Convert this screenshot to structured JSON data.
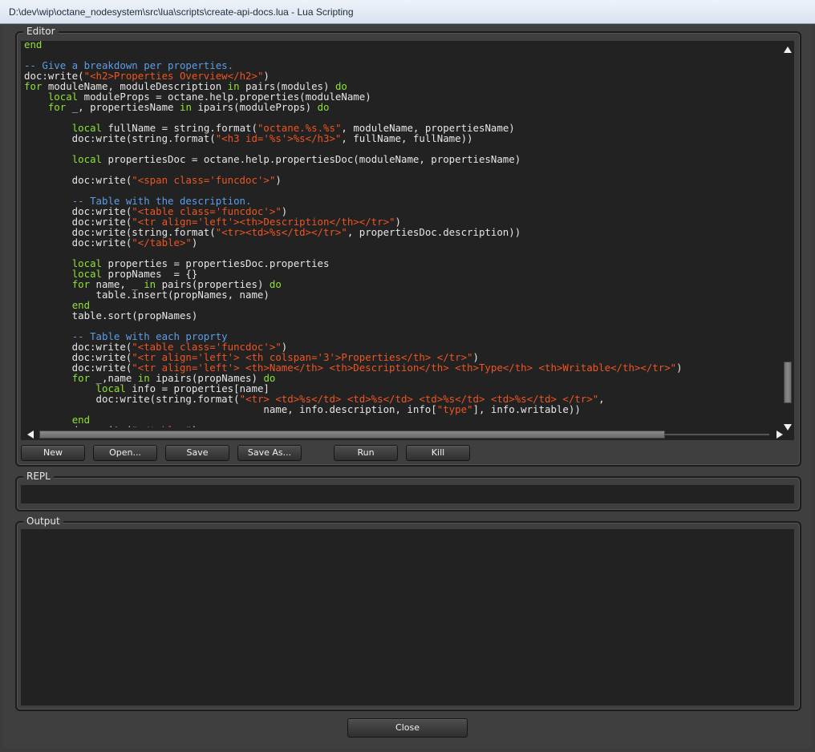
{
  "window": {
    "title": "D:\\dev\\wip\\octane_nodesystem\\src\\lua\\scripts\\create-api-docs.lua - Lua Scripting"
  },
  "editor": {
    "label": "Editor",
    "buttons": {
      "new": "New",
      "open": "Open...",
      "save": "Save",
      "save_as": "Save As...",
      "run": "Run",
      "kill": "Kill"
    }
  },
  "repl": {
    "label": "REPL",
    "value": ""
  },
  "output": {
    "label": "Output",
    "value": ""
  },
  "footer": {
    "close": "Close"
  },
  "code_lines": [
    [
      [
        "kw",
        "end"
      ]
    ],
    [],
    [
      [
        "cmt",
        "-- Give a breakdown per properties."
      ]
    ],
    [
      [
        "t",
        "doc:write("
      ],
      [
        "str",
        "\"<h2>Properties Overview</h2>\""
      ],
      [
        "t",
        ")"
      ]
    ],
    [
      [
        "kw",
        "for"
      ],
      [
        "t",
        " moduleName, moduleDescription "
      ],
      [
        "kw",
        "in"
      ],
      [
        "t",
        " pairs(modules) "
      ],
      [
        "kw",
        "do"
      ]
    ],
    [
      [
        "t",
        "    "
      ],
      [
        "kw",
        "local"
      ],
      [
        "t",
        " moduleProps = octane.help.properties(moduleName)"
      ]
    ],
    [
      [
        "t",
        "    "
      ],
      [
        "kw",
        "for"
      ],
      [
        "t",
        " _, propertiesName "
      ],
      [
        "kw",
        "in"
      ],
      [
        "t",
        " ipairs(moduleProps) "
      ],
      [
        "kw",
        "do"
      ]
    ],
    [],
    [
      [
        "t",
        "        "
      ],
      [
        "kw",
        "local"
      ],
      [
        "t",
        " fullName = string.format("
      ],
      [
        "str",
        "\"octane.%s.%s\""
      ],
      [
        "t",
        ", moduleName, propertiesName)"
      ]
    ],
    [
      [
        "t",
        "        doc:write(string.format("
      ],
      [
        "str",
        "\"<h3 id='%s'>%s</h3>\""
      ],
      [
        "t",
        ", fullName, fullName))"
      ]
    ],
    [],
    [
      [
        "t",
        "        "
      ],
      [
        "kw",
        "local"
      ],
      [
        "t",
        " propertiesDoc = octane.help.propertiesDoc(moduleName, propertiesName)"
      ]
    ],
    [],
    [
      [
        "t",
        "        doc:write("
      ],
      [
        "str",
        "\"<span class='funcdoc'>\""
      ],
      [
        "t",
        ")"
      ]
    ],
    [],
    [
      [
        "t",
        "        "
      ],
      [
        "cmt",
        "-- Table with the description."
      ]
    ],
    [
      [
        "t",
        "        doc:write("
      ],
      [
        "str",
        "\"<table class='funcdoc'>\""
      ],
      [
        "t",
        ")"
      ]
    ],
    [
      [
        "t",
        "        doc:write("
      ],
      [
        "str",
        "\"<tr align='left'><th>Description</th></tr>\""
      ],
      [
        "t",
        ")"
      ]
    ],
    [
      [
        "t",
        "        doc:write(string.format("
      ],
      [
        "str",
        "\"<tr><td>%s</td></tr>\""
      ],
      [
        "t",
        ", propertiesDoc.description))"
      ]
    ],
    [
      [
        "t",
        "        doc:write("
      ],
      [
        "str",
        "\"</table>\""
      ],
      [
        "t",
        ")"
      ]
    ],
    [],
    [
      [
        "t",
        "        "
      ],
      [
        "kw",
        "local"
      ],
      [
        "t",
        " properties = propertiesDoc.properties"
      ]
    ],
    [
      [
        "t",
        "        "
      ],
      [
        "kw",
        "local"
      ],
      [
        "t",
        " propNames  = {}"
      ]
    ],
    [
      [
        "t",
        "        "
      ],
      [
        "kw",
        "for"
      ],
      [
        "t",
        " name, _ "
      ],
      [
        "kw",
        "in"
      ],
      [
        "t",
        " pairs(properties) "
      ],
      [
        "kw",
        "do"
      ]
    ],
    [
      [
        "t",
        "            table.insert(propNames, name)"
      ]
    ],
    [
      [
        "t",
        "        "
      ],
      [
        "kw",
        "end"
      ]
    ],
    [
      [
        "t",
        "        table.sort(propNames)"
      ]
    ],
    [],
    [
      [
        "t",
        "        "
      ],
      [
        "cmt",
        "-- Table with each proprty"
      ]
    ],
    [
      [
        "t",
        "        doc:write("
      ],
      [
        "str",
        "\"<table class='funcdoc'>\""
      ],
      [
        "t",
        ")"
      ]
    ],
    [
      [
        "t",
        "        doc:write("
      ],
      [
        "str",
        "\"<tr align='left'> <th colspan='3'>Properties</th> </tr>\""
      ],
      [
        "t",
        ")"
      ]
    ],
    [
      [
        "t",
        "        doc:write("
      ],
      [
        "str",
        "\"<tr align='left'> <th>Name</th> <th>Description</th> <th>Type</th> <th>Writable</th></tr>\""
      ],
      [
        "t",
        ")"
      ]
    ],
    [
      [
        "t",
        "        "
      ],
      [
        "kw",
        "for"
      ],
      [
        "t",
        " _,name "
      ],
      [
        "kw",
        "in"
      ],
      [
        "t",
        " ipairs(propNames) "
      ],
      [
        "kw",
        "do"
      ]
    ],
    [
      [
        "t",
        "            "
      ],
      [
        "kw",
        "local"
      ],
      [
        "t",
        " info = properties[name]"
      ]
    ],
    [
      [
        "t",
        "            doc:write(string.format("
      ],
      [
        "str",
        "\"<tr> <td>%s</td> <td>%s</td> <td>%s</td> <td>%s</td> </tr>\""
      ],
      [
        "t",
        ","
      ]
    ],
    [
      [
        "t",
        "                                        name, info.description, info["
      ],
      [
        "str",
        "\"type\""
      ],
      [
        "t",
        "], info.writable))"
      ]
    ],
    [
      [
        "t",
        "        "
      ],
      [
        "kw",
        "end"
      ]
    ],
    [
      [
        "t",
        "        doc:write("
      ],
      [
        "str",
        "\"</table>\""
      ],
      [
        "t",
        ")"
      ]
    ]
  ]
}
